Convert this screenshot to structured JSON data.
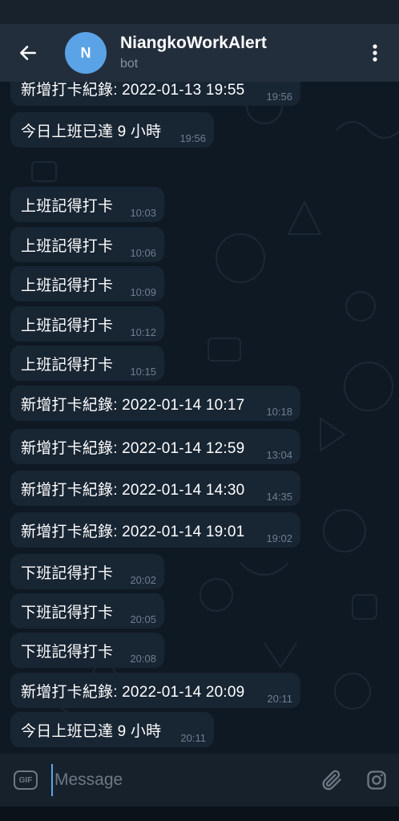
{
  "header": {
    "avatar_letter": "N",
    "title": "NiangkoWorkAlert",
    "subtitle": "bot"
  },
  "messages": [
    {
      "text": "新增打卡紀錄: 2022-01-13 19:55",
      "time": "19:56"
    },
    {
      "text": "今日上班已達 9 小時",
      "time": "19:56"
    },
    {
      "text": "上班記得打卡",
      "time": "10:03"
    },
    {
      "text": "上班記得打卡",
      "time": "10:06"
    },
    {
      "text": "上班記得打卡",
      "time": "10:09"
    },
    {
      "text": "上班記得打卡",
      "time": "10:12"
    },
    {
      "text": "上班記得打卡",
      "time": "10:15"
    },
    {
      "text": "新增打卡紀錄: 2022-01-14 10:17",
      "time": "10:18"
    },
    {
      "text": "新增打卡紀錄: 2022-01-14 12:59",
      "time": "13:04"
    },
    {
      "text": "新增打卡紀錄: 2022-01-14 14:30",
      "time": "14:35"
    },
    {
      "text": "新增打卡紀錄: 2022-01-14 19:01",
      "time": "19:02"
    },
    {
      "text": "下班記得打卡",
      "time": "20:02"
    },
    {
      "text": "下班記得打卡",
      "time": "20:05"
    },
    {
      "text": "下班記得打卡",
      "time": "20:08"
    },
    {
      "text": "新增打卡紀錄: 2022-01-14 20:09",
      "time": "20:11"
    },
    {
      "text": "今日上班已達 9 小時",
      "time": "20:11"
    }
  ],
  "input": {
    "gif_label": "GIF",
    "placeholder": "Message",
    "value": ""
  },
  "icons": {
    "back": "arrow-left-icon",
    "menu": "more-vertical-icon",
    "gif": "gif-icon",
    "attach": "paperclip-icon",
    "camera": "instagram-camera-icon"
  },
  "colors": {
    "header_bg": "#232e3c",
    "chat_bg": "#0f1923",
    "bubble_bg": "#182533",
    "avatar_bg": "#5aa3e6",
    "accent": "#5ea5e6",
    "time_text": "#6d7f8f"
  }
}
